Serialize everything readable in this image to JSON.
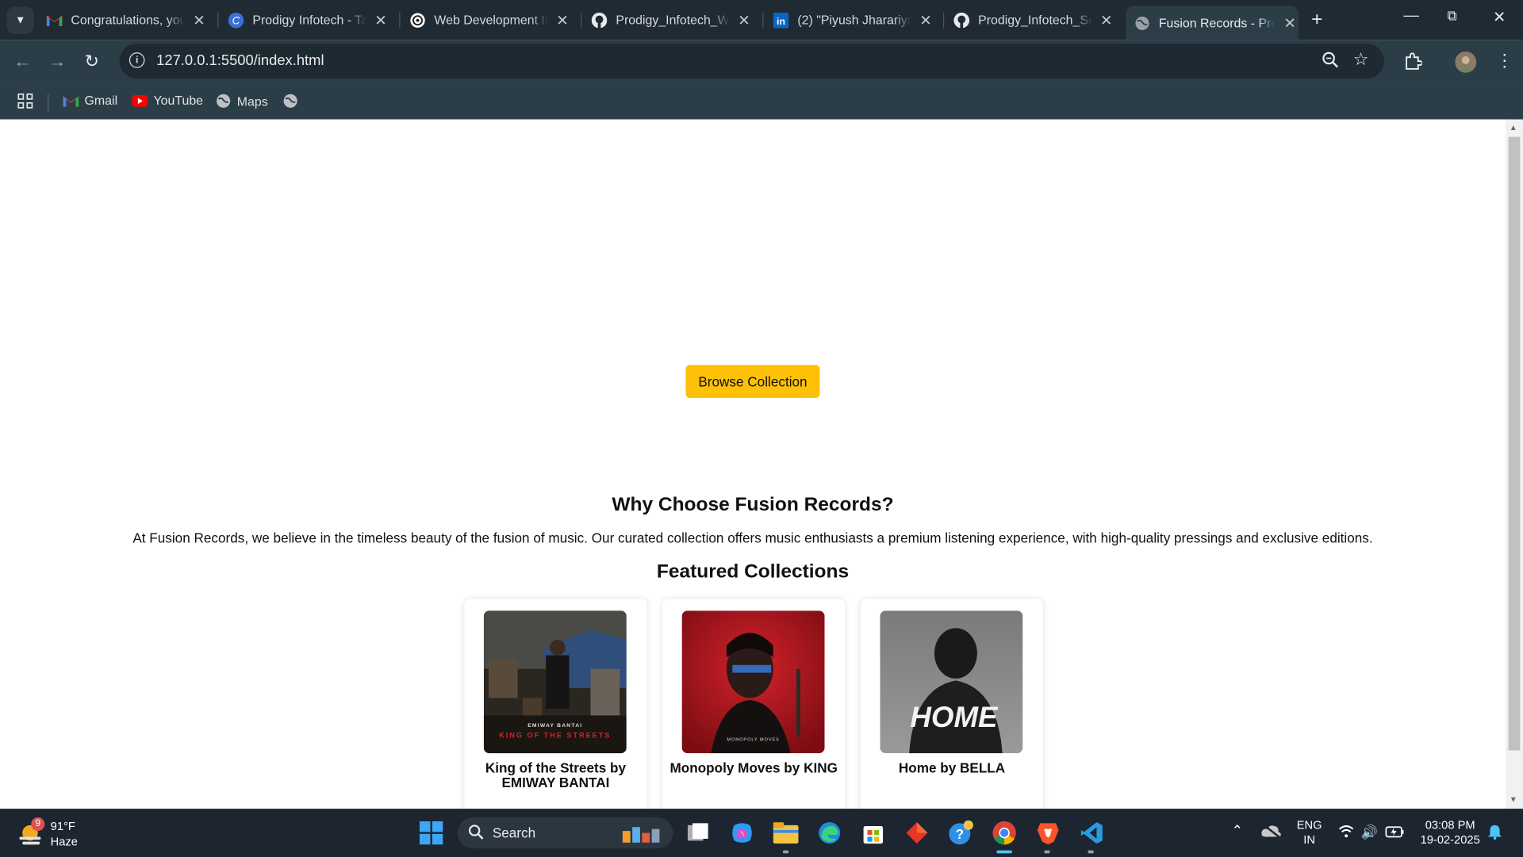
{
  "browser": {
    "tabs": [
      {
        "title": "Congratulations, you",
        "icon": "gmail-icon"
      },
      {
        "title": "Prodigy Infotech - Ta",
        "icon": "prodigy-icon"
      },
      {
        "title": "Web Development In",
        "icon": "openai-icon"
      },
      {
        "title": "Prodigy_Infotech_We",
        "icon": "github-icon"
      },
      {
        "title": "(2) \"Piyush Jharariya\"",
        "icon": "linkedin-icon"
      },
      {
        "title": "Prodigy_Infotech_Sof",
        "icon": "github-icon"
      },
      {
        "title": "Fusion Records - Pre",
        "icon": "globe-icon",
        "active": true
      }
    ],
    "url": "127.0.0.1:5500/index.html",
    "bookmarks": [
      {
        "label": "Gmail",
        "icon": "gmail-icon"
      },
      {
        "label": "YouTube",
        "icon": "youtube-icon"
      },
      {
        "label": "Maps",
        "icon": "globe-icon"
      },
      {
        "label": "",
        "icon": "globe-icon"
      }
    ]
  },
  "page": {
    "browse_button": "Browse Collection",
    "why_title": "Why Choose Fusion Records?",
    "why_text": "At Fusion Records, we believe in the timeless beauty of the fusion of music. Our curated collection offers music enthusiasts a premium listening experience, with high-quality pressings and exclusive editions.",
    "featured_title": "Featured Collections",
    "albums": [
      {
        "caption": "King of the Streets by EMIWAY BANTAI",
        "cover_artist": "EMIWAY BANTAI",
        "cover_title": "KING OF THE STREETS"
      },
      {
        "caption": "Monopoly Moves by KING",
        "cover_title": "MONOPOLY MOVES"
      },
      {
        "caption": "Home by BELLA",
        "cover_title": "HOME"
      }
    ]
  },
  "taskbar": {
    "weather_temp": "91°F",
    "weather_desc": "Haze",
    "weather_badge": "9",
    "search_placeholder": "Search",
    "lang_top": "ENG",
    "lang_bottom": "IN",
    "time": "03:08 PM",
    "date": "19-02-2025"
  },
  "colors": {
    "accent_button": "#ffc107",
    "browser_frame": "#2b3d47",
    "tabstrip": "#1f2a33",
    "taskbar": "#1c2530"
  }
}
